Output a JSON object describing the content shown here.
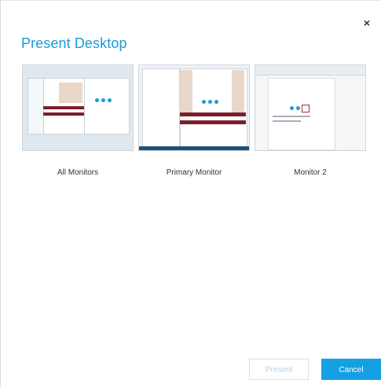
{
  "dialog": {
    "title": "Present Desktop",
    "close_glyph": "×"
  },
  "monitors": [
    {
      "label": "All Monitors"
    },
    {
      "label": "Primary Monitor"
    },
    {
      "label": "Monitor 2"
    }
  ],
  "buttons": {
    "present_label": "Present",
    "cancel_label": "Cancel"
  },
  "colors": {
    "accent": "#1b9bd7",
    "cancel_bg": "#16a0e4",
    "thumb_stripe": "#7a1f2b"
  }
}
